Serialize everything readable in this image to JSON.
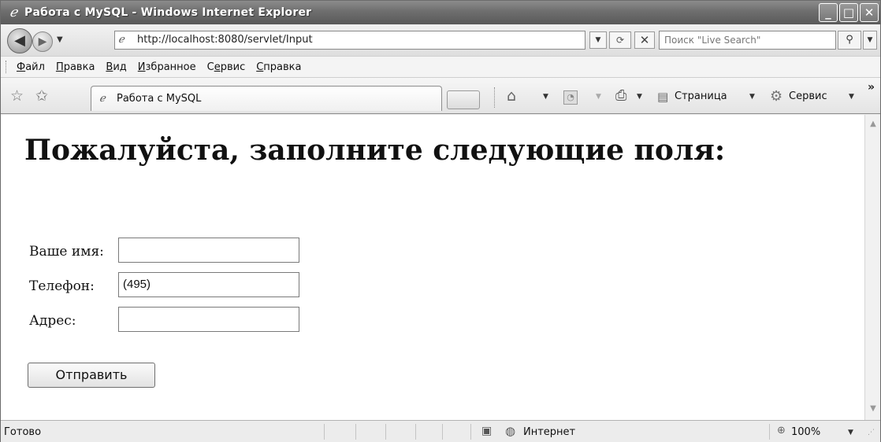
{
  "window": {
    "title": "Работа с MySQL - Windows Internet Explorer",
    "icon": "ie-logo-icon",
    "controls": {
      "minimize": "_",
      "maximize": "□",
      "close": "✕"
    }
  },
  "address_bar": {
    "url": "http://localhost:8080/servlet/Input",
    "search_placeholder": "Поиск \"Live Search\""
  },
  "menu": {
    "items": [
      {
        "label": "Файл",
        "underline": "Ф",
        "rest": "айл"
      },
      {
        "label": "Правка",
        "underline": "П",
        "rest": "равка"
      },
      {
        "label": "Вид",
        "underline": "В",
        "rest": "ид"
      },
      {
        "label": "Избранное",
        "underline": "И",
        "rest": "збранное"
      },
      {
        "label": "Сервис",
        "underline_pre": "С",
        "underline": "е",
        "rest": "рвис"
      },
      {
        "label": "Справка",
        "underline": "С",
        "rest": "правка"
      }
    ]
  },
  "tabs": {
    "active": "Работа с MySQL"
  },
  "command_bar": {
    "page_label": "Страница",
    "tools_label": "Сервис"
  },
  "page": {
    "heading": "Пожалуйста, заполните следующие поля:",
    "fields": [
      {
        "label": "Ваше имя:",
        "value": ""
      },
      {
        "label": "Телефон:",
        "value": "(495)"
      },
      {
        "label": "Адрес:",
        "value": ""
      }
    ],
    "submit_label": "Отправить"
  },
  "status_bar": {
    "status": "Готово",
    "zone": "Интернет",
    "zoom": "100%"
  }
}
